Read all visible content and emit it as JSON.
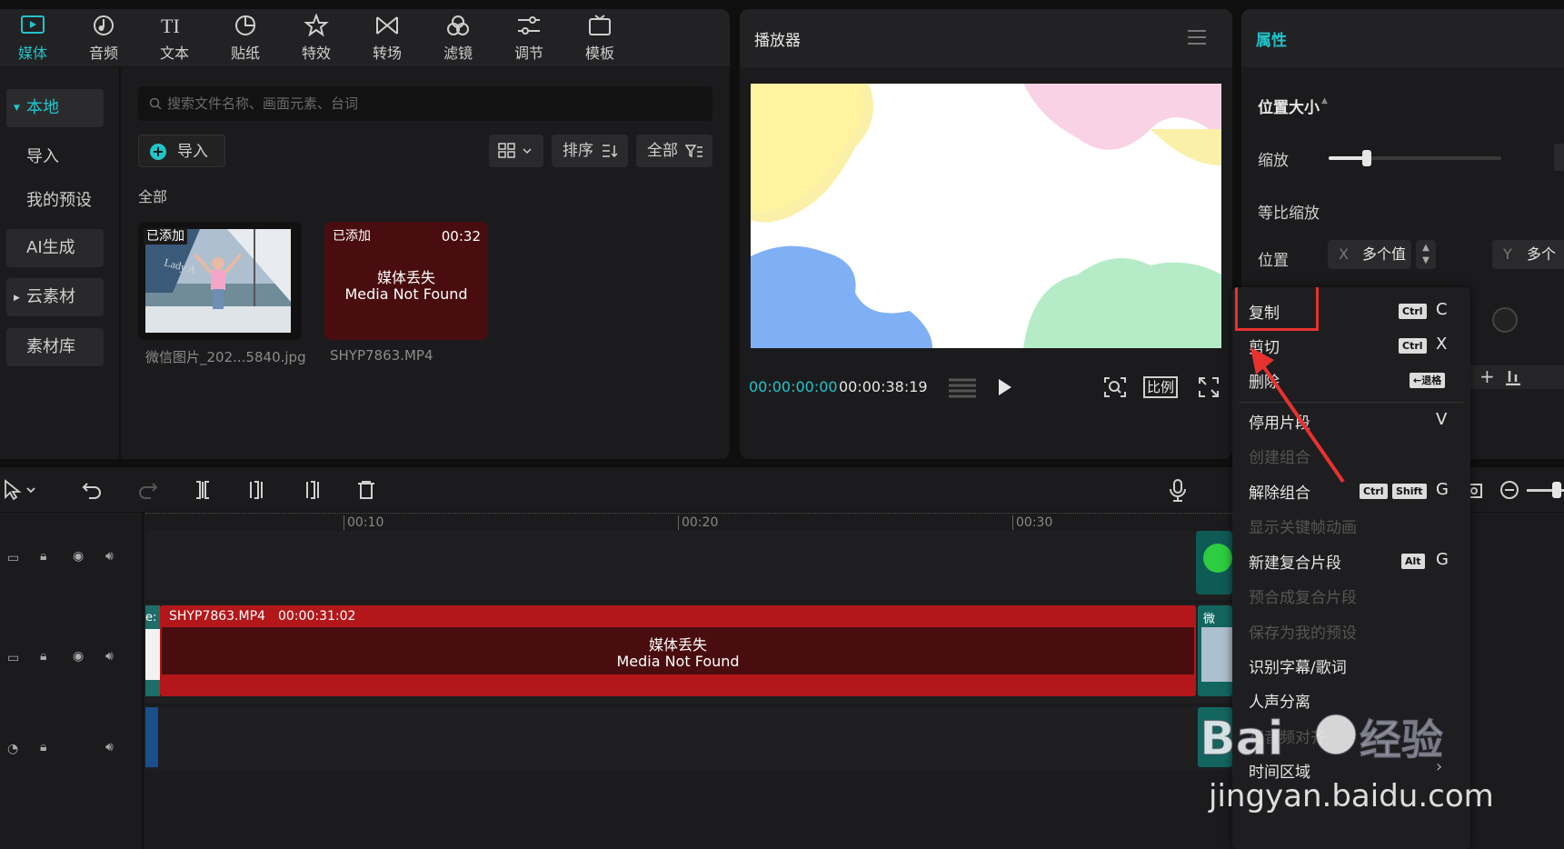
{
  "media_panel": {
    "tabs": [
      {
        "label": "媒体",
        "icon": "media-icon"
      },
      {
        "label": "音频",
        "icon": "audio-icon"
      },
      {
        "label": "文本",
        "icon": "text-icon"
      },
      {
        "label": "贴纸",
        "icon": "sticker-icon"
      },
      {
        "label": "特效",
        "icon": "effects-icon"
      },
      {
        "label": "转场",
        "icon": "transition-icon"
      },
      {
        "label": "滤镜",
        "icon": "filter-icon"
      },
      {
        "label": "调节",
        "icon": "adjust-icon"
      },
      {
        "label": "模板",
        "icon": "template-icon"
      }
    ],
    "side_items": [
      {
        "label": "本地"
      },
      {
        "label": "导入"
      },
      {
        "label": "我的预设"
      },
      {
        "label": "AI生成"
      },
      {
        "label": "云素材"
      },
      {
        "label": "素材库"
      }
    ],
    "search_placeholder": "搜索文件名称、画面元素、台词",
    "import_label": "导入",
    "sort_label": "排序",
    "all_filter_label": "全部",
    "section_label": "全部",
    "assets": [
      {
        "badge": "已添加",
        "filename": "微信图片_202...5840.jpg",
        "duration": ""
      },
      {
        "badge": "已添加",
        "filename": "SHYP7863.MP4",
        "duration": "00:32",
        "missing_cn": "媒体丢失",
        "missing_en": "Media Not Found"
      }
    ]
  },
  "player": {
    "title": "播放器",
    "current_time": "00:00:00:00",
    "total_time": "00:00:38:19",
    "ratio_label": "比例"
  },
  "properties": {
    "title": "属性",
    "section": "位置大小",
    "scale_label": "缩放",
    "scale_fraction": 0.22,
    "uniform_scale_label": "等比缩放",
    "position_label": "位置",
    "x_axis": "X",
    "y_axis": "Y",
    "x_value": "多个值",
    "y_value": "多个"
  },
  "timeline": {
    "ruler": [
      "00:10",
      "00:20",
      "00:30"
    ],
    "clip": {
      "name": "SHYP7863.MP4",
      "duration": "00:00:31:02",
      "missing_cn": "媒体丢失",
      "missing_en": "Media Not Found",
      "prev_label": "e:"
    },
    "side_clip_label": "微"
  },
  "context_menu": {
    "items": [
      {
        "label": "复制",
        "keys": [
          "Ctrl"
        ],
        "key": "C",
        "disabled": false
      },
      {
        "label": "剪切",
        "keys": [
          "Ctrl"
        ],
        "key": "X",
        "disabled": false
      },
      {
        "label": "删除",
        "keys": [
          "←退格"
        ],
        "key": "",
        "disabled": false
      },
      {
        "label": "停用片段",
        "keys": [],
        "key": "V",
        "disabled": false
      },
      {
        "label": "创建组合",
        "keys": [],
        "key": "",
        "disabled": true
      },
      {
        "label": "解除组合",
        "keys": [
          "Ctrl",
          "Shift"
        ],
        "key": "G",
        "disabled": false
      },
      {
        "label": "显示关键帧动画",
        "keys": [],
        "key": "",
        "disabled": true
      },
      {
        "label": "新建复合片段",
        "keys": [
          "Alt"
        ],
        "key": "G",
        "disabled": false
      },
      {
        "label": "预合成复合片段",
        "keys": [],
        "key": "",
        "disabled": true
      },
      {
        "label": "保存为我的预设",
        "keys": [],
        "key": "",
        "disabled": true
      },
      {
        "label": "识别字幕/歌词",
        "keys": [],
        "key": "",
        "disabled": false
      },
      {
        "label": "人声分离",
        "keys": [],
        "key": "",
        "disabled": false
      },
      {
        "label": "视音频对齐",
        "keys": [],
        "key": "",
        "disabled": true
      },
      {
        "label": "时间区域",
        "keys": [],
        "key": "›",
        "disabled": false
      }
    ]
  },
  "watermark": {
    "brand": "Baidu经验",
    "url": "jingyan.baidu.com"
  },
  "colors": {
    "accent": "#22c4c8",
    "highlight": "#e8322f",
    "clip_red": "#b3171a",
    "clip_dark": "#4a0d0f"
  }
}
